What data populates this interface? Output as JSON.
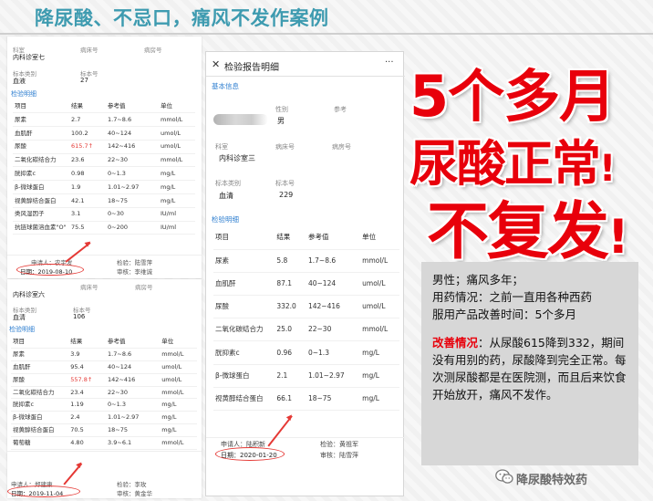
{
  "header": {
    "title": "降尿酸、不忌口，痛风不发作案例"
  },
  "headline": {
    "line1": "5个多月",
    "line2": "尿酸正常",
    "excl2": "!",
    "line3": "不复发",
    "excl3": "!"
  },
  "summary": {
    "line1": "男性；痛风多年；",
    "line2": "用药情况：之前一直用各种西药",
    "line3": "服用产品改善时间：5个多月",
    "improve_label": "改善情况",
    "improve_text": "：从尿酸615降到332，期间没有用别的药，尿酸降到完全正常。每次测尿酸都是在医院测，而且后来饮食开始放开，痛风不发作。"
  },
  "brand": {
    "name": "降尿酸特效药",
    "icon": "wechat-icon"
  },
  "colors": {
    "red": "#e8000b",
    "header": "#3e9bb0",
    "link": "#2f7fd0"
  },
  "report1": {
    "dept_label": "科室",
    "dept": "内科诊室七",
    "bed_label": "病床号",
    "room_label": "病房号",
    "sample_label": "标本类别",
    "sample": "血液",
    "sample_no_label": "标本号",
    "sample_no": "27",
    "section": "检验明细",
    "headers": [
      "项目",
      "结果",
      "参考值",
      "单位"
    ],
    "rows": [
      [
        "尿素",
        "2.7",
        "1.7~8.6",
        "mmol/L"
      ],
      [
        "血肌酐",
        "100.2",
        "40~124",
        "umol/L"
      ],
      [
        "尿酸",
        "615.7↑",
        "142~416",
        "umol/L"
      ],
      [
        "二氧化碳结合力",
        "23.6",
        "22~30",
        "mmol/L"
      ],
      [
        "胱抑素c",
        "0.98",
        "0~1.3",
        "mg/L"
      ],
      [
        "β-微球蛋白",
        "1.9",
        "1.01~2.97",
        "mg/L"
      ],
      [
        "视黄醇结合蛋白",
        "42.1",
        "18~75",
        "mg/L"
      ],
      [
        "类风湿因子",
        "3.1",
        "0~30",
        "IU/ml"
      ],
      [
        "抗链球菌溶血素\"O\"",
        "75.5",
        "0~200",
        "IU/ml"
      ]
    ],
    "applicant_label": "申请人：",
    "applicant": "农宇发",
    "checker_label": "检验：",
    "checker": "陆雪萍",
    "date_label": "日期：",
    "date": "2019-08-10",
    "reviewer_label": "审核：",
    "reviewer": "李维诚"
  },
  "report2": {
    "dept_label": "科室",
    "dept": "内科诊室六",
    "bed_label": "病床号",
    "room_label": "病房号",
    "sample_label": "标本类别",
    "sample": "血清",
    "sample_no_label": "标本号",
    "sample_no": "106",
    "section": "检验明细",
    "headers": [
      "项目",
      "结果",
      "参考值",
      "单位"
    ],
    "rows": [
      [
        "尿素",
        "3.9",
        "1.7~8.6",
        "mmol/L"
      ],
      [
        "血肌酐",
        "95.4",
        "40~124",
        "umol/L"
      ],
      [
        "尿酸",
        "557.8↑",
        "142~416",
        "umol/L"
      ],
      [
        "二氧化碳结合力",
        "23.4",
        "22~30",
        "mmol/L"
      ],
      [
        "胱抑素c",
        "1.19",
        "0~1.3",
        "mg/L"
      ],
      [
        "β-微球蛋白",
        "2.4",
        "1.01~2.97",
        "mg/L"
      ],
      [
        "视黄醇结合蛋白",
        "70.5",
        "18~75",
        "mg/L"
      ],
      [
        "葡萄糖",
        "4.80",
        "3.9~6.1",
        "mmol/L"
      ]
    ],
    "applicant_label": "申请人：",
    "applicant": "郑建康",
    "checker_label": "检验：",
    "checker": "李玫",
    "date_label": "日期：",
    "date": "2019-11-04",
    "reviewer_label": "审核：",
    "reviewer": "黄金华"
  },
  "report3": {
    "window_title": "检验报告明细",
    "close_glyph": "✕",
    "more_glyph": "···",
    "basic_section": "基本信息",
    "gender_label": "性别",
    "gender": "男",
    "ref_label": "参考",
    "dept_label": "科室",
    "dept": "内科诊室三",
    "bed_label": "病床号",
    "room_label": "病房号",
    "sample_label": "标本类别",
    "sample": "血清",
    "sample_no_label": "标本号",
    "sample_no": "229",
    "section": "检验明细",
    "headers": [
      "项目",
      "结果",
      "参考值",
      "单位"
    ],
    "rows": [
      [
        "尿素",
        "5.8",
        "1.7~8.6",
        "mmol/L"
      ],
      [
        "血肌酐",
        "87.1",
        "40~124",
        "umol/L"
      ],
      [
        "尿酸",
        "332.0",
        "142~416",
        "umol/L"
      ],
      [
        "二氧化碳结合力",
        "25.0",
        "22~30",
        "mmol/L"
      ],
      [
        "胱抑素c",
        "0.96",
        "0~1.3",
        "mg/L"
      ],
      [
        "β-微球蛋白",
        "2.1",
        "1.01~2.97",
        "mg/L"
      ],
      [
        "视黄醇结合蛋白",
        "66.1",
        "18~75",
        "mg/L"
      ]
    ],
    "applicant_label": "申请人：",
    "applicant": "陆积新",
    "checker_label": "检验：",
    "checker": "黄祖军",
    "date_label": "日期：",
    "date": "2020-01-20",
    "reviewer_label": "审核：",
    "reviewer": "陆雪萍"
  }
}
